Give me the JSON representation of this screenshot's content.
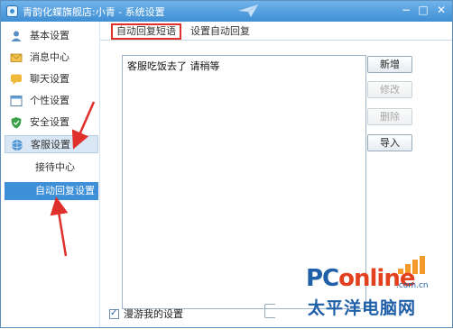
{
  "window": {
    "title": "青韵化蝶旗舰店:小青 - 系统设置",
    "controls": {
      "minimize": "−",
      "maximize": "□",
      "close": "✕"
    }
  },
  "sidebar": {
    "items": [
      {
        "label": "基本设置",
        "icon": "person-icon"
      },
      {
        "label": "消息中心",
        "icon": "envelope-icon"
      },
      {
        "label": "聊天设置",
        "icon": "chat-icon"
      },
      {
        "label": "个性设置",
        "icon": "window-icon"
      },
      {
        "label": "安全设置",
        "icon": "shield-icon"
      },
      {
        "label": "客服设置",
        "icon": "globe-icon",
        "selected": true
      }
    ],
    "subitems": [
      {
        "label": "接待中心"
      },
      {
        "label": "自动回复设置",
        "selected": true
      }
    ]
  },
  "tabs": [
    {
      "label": "自动回复短语",
      "active": true
    },
    {
      "label": "设置自动回复"
    }
  ],
  "phrase_list": {
    "items": [
      "客服吃饭去了 请稍等"
    ]
  },
  "buttons": {
    "add": "新增",
    "edit": "修改",
    "delete": "删除",
    "import": "导入"
  },
  "roaming_checkbox": {
    "label": "漫游我的设置",
    "checked": true
  },
  "watermark": {
    "brand_pc": "PC",
    "brand_online": "online",
    "domain": ".com.cn",
    "chinese": "太平洋电脑网"
  },
  "colors": {
    "titlebar": "#3f8fd4",
    "selected_subitem": "#3d8fd8",
    "annotation_red": "#e0302b"
  }
}
